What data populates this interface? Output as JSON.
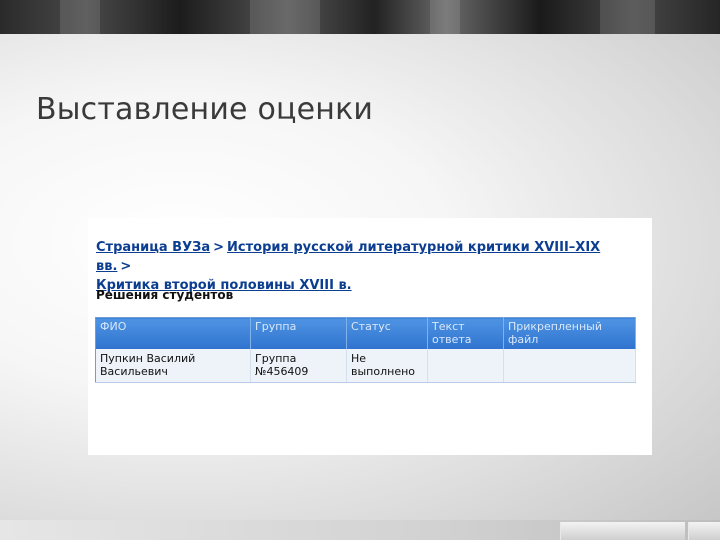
{
  "slide": {
    "title": "Выставление оценки"
  },
  "breadcrumb": {
    "items": [
      "Страница ВУЗа",
      "История русской литературной критики XVIII–XIX вв.",
      "Критика второй половины XVIII в."
    ],
    "separator": ">"
  },
  "section": {
    "title": "Решения студентов"
  },
  "table": {
    "headers": [
      "ФИО",
      "Группа",
      "Статус",
      "Текст ответа",
      "Прикрепленный файл"
    ],
    "rows": [
      {
        "name": "Пупкин Василий Васильевич",
        "group": "Группа №456409",
        "status": "Не выполнено",
        "answer_text": "",
        "attached_file": ""
      }
    ]
  },
  "colors": {
    "link": "#0b3d91",
    "header_bg": "#3a80d8",
    "header_text": "#d9e8fb",
    "row_bg": "#eef3fa"
  }
}
